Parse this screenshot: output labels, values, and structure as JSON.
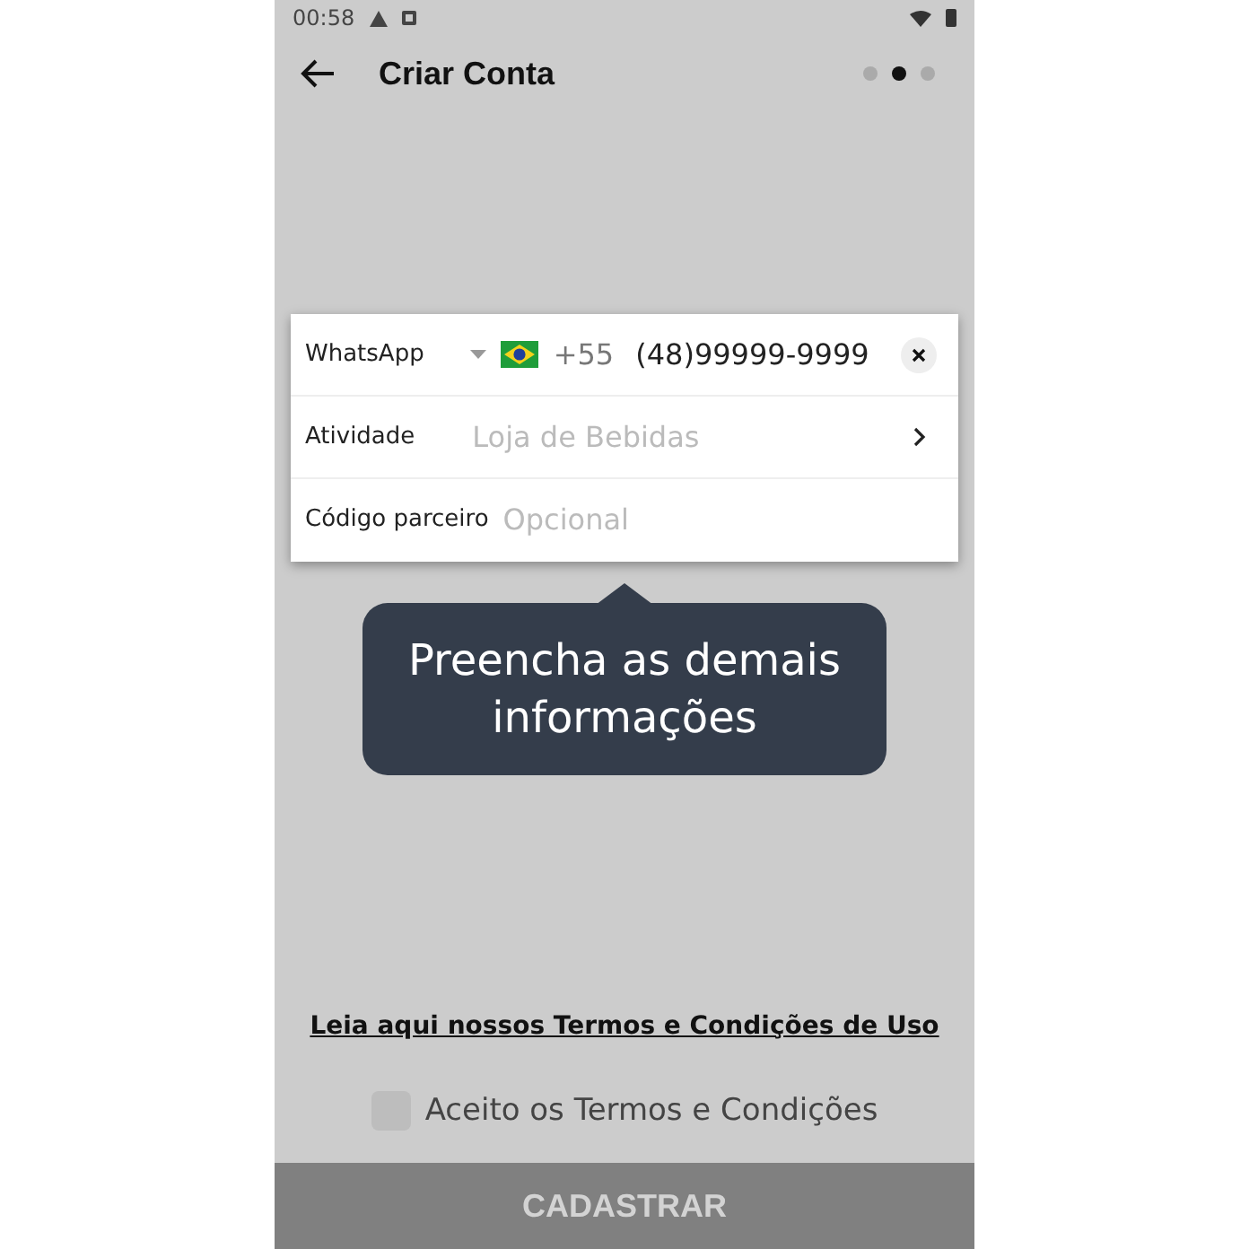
{
  "status_bar": {
    "time": "00:58"
  },
  "header": {
    "title": "Criar Conta",
    "steps": [
      {
        "selected": false
      },
      {
        "selected": true
      },
      {
        "selected": false
      }
    ]
  },
  "form": {
    "rows": [
      {
        "kind": "phone",
        "label": "WhatsApp",
        "country_code": "+55",
        "value": "(48)99999-9999"
      },
      {
        "kind": "select",
        "label": "Atividade",
        "placeholder": "Loja de Bebidas"
      },
      {
        "kind": "text",
        "label": "Código parceiro",
        "placeholder": "Opcional"
      }
    ]
  },
  "tooltip": {
    "text": "Preencha as demais informações"
  },
  "terms_link": "Leia aqui nossos Termos e Condições de Uso",
  "accept": {
    "label": "Aceito os Termos e Condições",
    "checked": false
  },
  "submit": {
    "label": "CADASTRAR",
    "disabled": true
  }
}
